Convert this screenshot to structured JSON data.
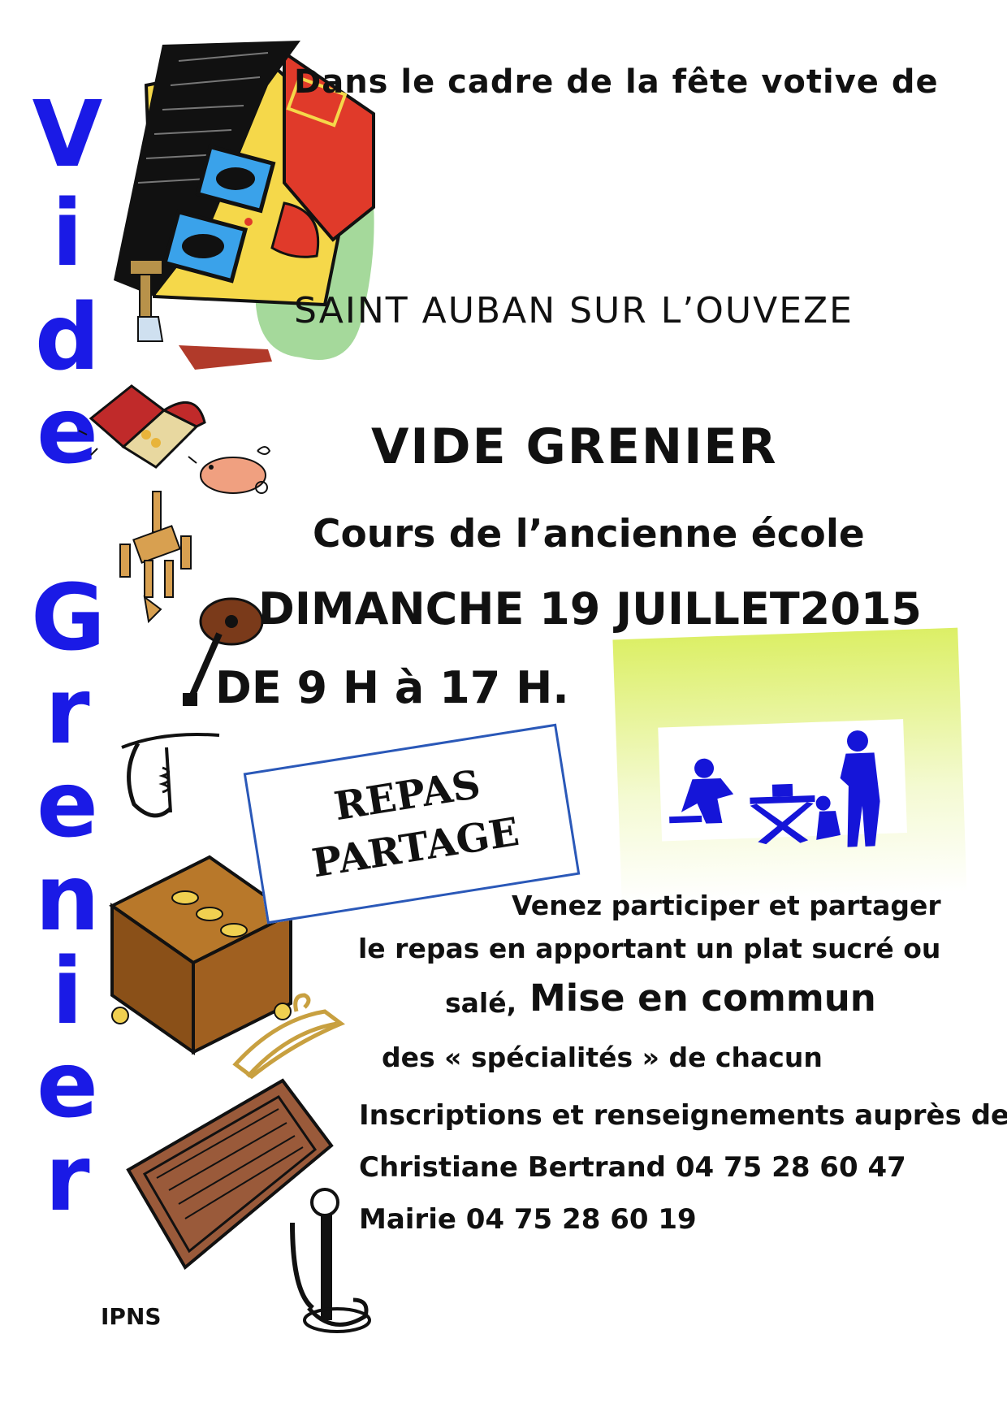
{
  "vertical_title": {
    "letters": [
      "V",
      "i",
      "d",
      "e",
      "G",
      "r",
      "e",
      "n",
      "i",
      "e",
      "r"
    ]
  },
  "header": {
    "line1": "Dans le cadre de la fête votive de",
    "village": "SAINT AUBAN SUR L’OUVEZE"
  },
  "event": {
    "title": "VIDE GRENIER",
    "location": "Cours de l’ancienne école",
    "date": "DIMANCHE 19 JUILLET2015",
    "hours": "DE 9 H à 17 H."
  },
  "repas": {
    "line1": "REPAS",
    "line2": "PARTAGE"
  },
  "description": {
    "line1": "Venez participer et partager",
    "line2": "le repas en apportant un plat sucré ou",
    "line3a": "salé,",
    "line3b": "Mise en commun",
    "line4": "des « spécialités » de chacun"
  },
  "contact": {
    "line1": "Inscriptions et renseignements auprès de",
    "line2": "Christiane Bertrand 04 75 28 60 47",
    "line3": "Mairie 04 75 28 60 19"
  },
  "footer": {
    "ipns": "IPNS"
  },
  "colors": {
    "title_blue": "#1a1ae6",
    "box_border": "#2a58b8",
    "picnic_blue": "#1515d8"
  }
}
